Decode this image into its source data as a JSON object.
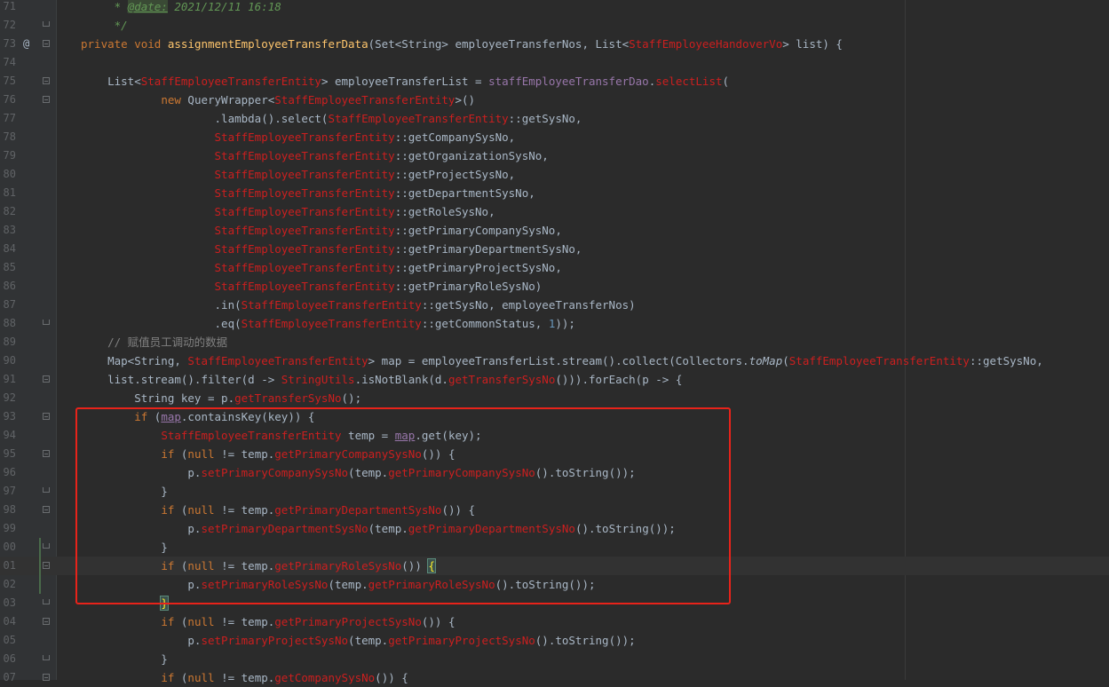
{
  "editor": {
    "lines": [
      {
        "n": "71",
        "segs": [
          {
            "t": "     * ",
            "c": "doc"
          },
          {
            "t": "@date:",
            "c": "doc-tag"
          },
          {
            "t": " 2021/12/11 16:18",
            "c": "doc"
          }
        ]
      },
      {
        "n": "72",
        "segs": [
          {
            "t": "     */",
            "c": "doc"
          }
        ]
      },
      {
        "n": "73",
        "segs": [
          {
            "t": "private void ",
            "c": "kw"
          },
          {
            "t": "assignmentEmployeeTransferData",
            "c": "fn"
          },
          {
            "t": "(Set<String> employeeTransferNos, List<"
          },
          {
            "t": "StaffEmployeeHandoverVo",
            "c": "cls"
          },
          {
            "t": "> list) {"
          }
        ]
      },
      {
        "n": "74",
        "segs": []
      },
      {
        "n": "75",
        "segs": [
          {
            "t": "    List<"
          },
          {
            "t": "StaffEmployeeTransferEntity",
            "c": "cls"
          },
          {
            "t": "> employeeTransferList = "
          },
          {
            "t": "staffEmployeeTransferDao",
            "c": "fld"
          },
          {
            "t": "."
          },
          {
            "t": "selectList",
            "c": "m"
          },
          {
            "t": "("
          }
        ]
      },
      {
        "n": "76",
        "segs": [
          {
            "t": "            "
          },
          {
            "t": "new ",
            "c": "kw"
          },
          {
            "t": "QueryWrapper<"
          },
          {
            "t": "StaffEmployeeTransferEntity",
            "c": "cls"
          },
          {
            "t": ">()"
          }
        ]
      },
      {
        "n": "77",
        "segs": [
          {
            "t": "                    .lambda().select("
          },
          {
            "t": "StaffEmployeeTransferEntity",
            "c": "cls"
          },
          {
            "t": "::getSysNo,"
          }
        ]
      },
      {
        "n": "78",
        "segs": [
          {
            "t": "                    "
          },
          {
            "t": "StaffEmployeeTransferEntity",
            "c": "cls"
          },
          {
            "t": "::getCompanySysNo,"
          }
        ]
      },
      {
        "n": "79",
        "segs": [
          {
            "t": "                    "
          },
          {
            "t": "StaffEmployeeTransferEntity",
            "c": "cls"
          },
          {
            "t": "::getOrganizationSysNo,"
          }
        ]
      },
      {
        "n": "80",
        "segs": [
          {
            "t": "                    "
          },
          {
            "t": "StaffEmployeeTransferEntity",
            "c": "cls"
          },
          {
            "t": "::getProjectSysNo,"
          }
        ]
      },
      {
        "n": "81",
        "segs": [
          {
            "t": "                    "
          },
          {
            "t": "StaffEmployeeTransferEntity",
            "c": "cls"
          },
          {
            "t": "::getDepartmentSysNo,"
          }
        ]
      },
      {
        "n": "82",
        "segs": [
          {
            "t": "                    "
          },
          {
            "t": "StaffEmployeeTransferEntity",
            "c": "cls"
          },
          {
            "t": "::getRoleSysNo,"
          }
        ]
      },
      {
        "n": "83",
        "segs": [
          {
            "t": "                    "
          },
          {
            "t": "StaffEmployeeTransferEntity",
            "c": "cls"
          },
          {
            "t": "::getPrimaryCompanySysNo,"
          }
        ]
      },
      {
        "n": "84",
        "segs": [
          {
            "t": "                    "
          },
          {
            "t": "StaffEmployeeTransferEntity",
            "c": "cls"
          },
          {
            "t": "::getPrimaryDepartmentSysNo,"
          }
        ]
      },
      {
        "n": "85",
        "segs": [
          {
            "t": "                    "
          },
          {
            "t": "StaffEmployeeTransferEntity",
            "c": "cls"
          },
          {
            "t": "::getPrimaryProjectSysNo,"
          }
        ]
      },
      {
        "n": "86",
        "segs": [
          {
            "t": "                    "
          },
          {
            "t": "StaffEmployeeTransferEntity",
            "c": "cls"
          },
          {
            "t": "::getPrimaryRoleSysNo)"
          }
        ]
      },
      {
        "n": "87",
        "segs": [
          {
            "t": "                    .in("
          },
          {
            "t": "StaffEmployeeTransferEntity",
            "c": "cls"
          },
          {
            "t": "::getSysNo, employeeTransferNos)"
          }
        ]
      },
      {
        "n": "88",
        "segs": [
          {
            "t": "                    .eq("
          },
          {
            "t": "StaffEmployeeTransferEntity",
            "c": "cls"
          },
          {
            "t": "::getCommonStatus, "
          },
          {
            "t": "1",
            "c": "num"
          },
          {
            "t": "));"
          }
        ]
      },
      {
        "n": "89",
        "segs": [
          {
            "t": "    "
          },
          {
            "t": "// 赋值员工调动的数据",
            "c": "cmt"
          }
        ]
      },
      {
        "n": "90",
        "segs": [
          {
            "t": "    Map<String, "
          },
          {
            "t": "StaffEmployeeTransferEntity",
            "c": "cls"
          },
          {
            "t": "> map = employeeTransferList.stream().collect(Collectors."
          },
          {
            "t": "toMap",
            "c": "ital"
          },
          {
            "t": "("
          },
          {
            "t": "StaffEmployeeTransferEntity",
            "c": "cls"
          },
          {
            "t": "::getSysNo,"
          }
        ]
      },
      {
        "n": "91",
        "segs": [
          {
            "t": "    list.stream().filter(d -> "
          },
          {
            "t": "StringUtils",
            "c": "cls"
          },
          {
            "t": ".isNotBlank(d."
          },
          {
            "t": "getTransferSysNo",
            "c": "m"
          },
          {
            "t": "())).forEach(p -> {"
          }
        ]
      },
      {
        "n": "92",
        "segs": [
          {
            "t": "        String key = p."
          },
          {
            "t": "getTransferSysNo",
            "c": "m"
          },
          {
            "t": "();"
          }
        ]
      },
      {
        "n": "93",
        "segs": [
          {
            "t": "        "
          },
          {
            "t": "if ",
            "c": "kw"
          },
          {
            "t": "("
          },
          {
            "t": "map",
            "c": "fld-u"
          },
          {
            "t": ".containsKey(key)) {"
          }
        ]
      },
      {
        "n": "94",
        "segs": [
          {
            "t": "            "
          },
          {
            "t": "StaffEmployeeTransferEntity",
            "c": "cls"
          },
          {
            "t": " temp = "
          },
          {
            "t": "map",
            "c": "fld-u"
          },
          {
            "t": ".get(key);"
          }
        ]
      },
      {
        "n": "95",
        "segs": [
          {
            "t": "            "
          },
          {
            "t": "if ",
            "c": "kw"
          },
          {
            "t": "("
          },
          {
            "t": "null ",
            "c": "kw"
          },
          {
            "t": "!= temp."
          },
          {
            "t": "getPrimaryCompanySysNo",
            "c": "m"
          },
          {
            "t": "()) {"
          }
        ]
      },
      {
        "n": "96",
        "segs": [
          {
            "t": "                p."
          },
          {
            "t": "setPrimaryCompanySysNo",
            "c": "m"
          },
          {
            "t": "(temp."
          },
          {
            "t": "getPrimaryCompanySysNo",
            "c": "m"
          },
          {
            "t": "().toString());"
          }
        ]
      },
      {
        "n": "97",
        "segs": [
          {
            "t": "            }"
          }
        ]
      },
      {
        "n": "98",
        "segs": [
          {
            "t": "            "
          },
          {
            "t": "if ",
            "c": "kw"
          },
          {
            "t": "("
          },
          {
            "t": "null ",
            "c": "kw"
          },
          {
            "t": "!= temp."
          },
          {
            "t": "getPrimaryDepartmentSysNo",
            "c": "m"
          },
          {
            "t": "()) {"
          }
        ]
      },
      {
        "n": "99",
        "segs": [
          {
            "t": "                p."
          },
          {
            "t": "setPrimaryDepartmentSysNo",
            "c": "m"
          },
          {
            "t": "(temp."
          },
          {
            "t": "getPrimaryDepartmentSysNo",
            "c": "m"
          },
          {
            "t": "().toString());"
          }
        ]
      },
      {
        "n": "00",
        "segs": [
          {
            "t": "            }"
          }
        ]
      },
      {
        "n": "01",
        "current": true,
        "segs": [
          {
            "t": "            "
          },
          {
            "t": "if ",
            "c": "kw"
          },
          {
            "t": "("
          },
          {
            "t": "null ",
            "c": "kw"
          },
          {
            "t": "!= temp."
          },
          {
            "t": "getPrimaryRoleSysNo",
            "c": "m"
          },
          {
            "t": "()) "
          },
          {
            "t": "{",
            "c": "brace-hl"
          }
        ]
      },
      {
        "n": "02",
        "segs": [
          {
            "t": "                p."
          },
          {
            "t": "setPrimaryRoleSysNo",
            "c": "m"
          },
          {
            "t": "(temp."
          },
          {
            "t": "getPrimaryRoleSysNo",
            "c": "m"
          },
          {
            "t": "().toString());"
          }
        ]
      },
      {
        "n": "03",
        "segs": [
          {
            "t": "            "
          },
          {
            "t": "}",
            "c": "brace-hl"
          }
        ]
      },
      {
        "n": "04",
        "segs": [
          {
            "t": "            "
          },
          {
            "t": "if ",
            "c": "kw"
          },
          {
            "t": "("
          },
          {
            "t": "null ",
            "c": "kw"
          },
          {
            "t": "!= temp."
          },
          {
            "t": "getPrimaryProjectSysNo",
            "c": "m"
          },
          {
            "t": "()) {"
          }
        ]
      },
      {
        "n": "05",
        "segs": [
          {
            "t": "                p."
          },
          {
            "t": "setPrimaryProjectSysNo",
            "c": "m"
          },
          {
            "t": "(temp."
          },
          {
            "t": "getPrimaryProjectSysNo",
            "c": "m"
          },
          {
            "t": "().toString());"
          }
        ]
      },
      {
        "n": "06",
        "segs": [
          {
            "t": "            }"
          }
        ]
      },
      {
        "n": "07",
        "segs": [
          {
            "t": "            "
          },
          {
            "t": "if ",
            "c": "kw"
          },
          {
            "t": "("
          },
          {
            "t": "null ",
            "c": "kw"
          },
          {
            "t": "!= temp."
          },
          {
            "t": "getCompanySysNo",
            "c": "m"
          },
          {
            "t": "()) {"
          }
        ]
      }
    ],
    "gutter_marker": "@"
  }
}
